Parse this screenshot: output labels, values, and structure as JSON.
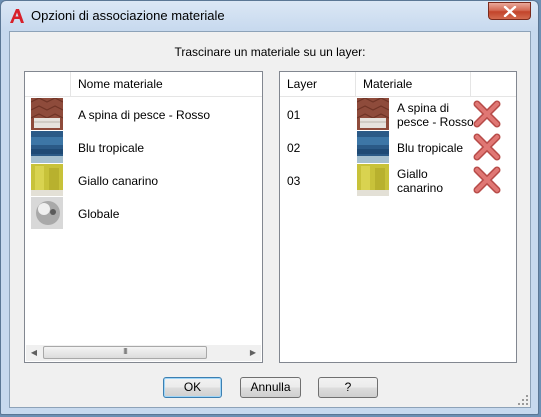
{
  "window": {
    "title": "Opzioni di associazione materiale",
    "icon": "autocad-a-icon"
  },
  "instructions": "Trascinare un materiale su un layer:",
  "materials_panel": {
    "header": "Nome materiale",
    "items": [
      {
        "name": "A spina di pesce - Rosso",
        "swatch": "herringbone-red"
      },
      {
        "name": "Blu tropicale",
        "swatch": "tropical-blue"
      },
      {
        "name": "Giallo canarino",
        "swatch": "canary-yellow"
      },
      {
        "name": "Globale",
        "swatch": "global-sphere"
      }
    ]
  },
  "layers_panel": {
    "headers": {
      "layer": "Layer",
      "material": "Materiale"
    },
    "rows": [
      {
        "layer": "01",
        "material_line1": "A spina di",
        "material_line2": "pesce - Rosso",
        "swatch": "herringbone-red",
        "action_icon": "delete-x-icon"
      },
      {
        "layer": "02",
        "material_line1": "Blu tropicale",
        "material_line2": "",
        "swatch": "tropical-blue",
        "action_icon": "delete-x-icon"
      },
      {
        "layer": "03",
        "material_line1": "Giallo",
        "material_line2": "canarino",
        "swatch": "canary-yellow",
        "action_icon": "delete-x-icon"
      }
    ]
  },
  "scrollbar": {
    "grip": "III"
  },
  "buttons": {
    "ok": "OK",
    "cancel": "Annulla",
    "help": "?"
  },
  "colors": {
    "titlebar": "#c7d9ee",
    "close_button": "#c2442a",
    "delete_x": "#d9534f"
  }
}
